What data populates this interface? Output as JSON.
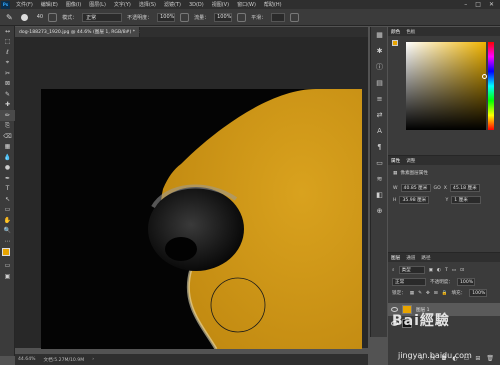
{
  "menubar": {
    "logo": "Ps",
    "items": [
      "文件(F)",
      "编辑(E)",
      "图像(I)",
      "图层(L)",
      "文字(Y)",
      "选择(S)",
      "滤镜(T)",
      "3D(D)",
      "视图(V)",
      "窗口(W)",
      "帮助(H)"
    ],
    "minimize": "–",
    "maximize": "□",
    "close": "✕"
  },
  "options": {
    "brush_size": "40",
    "mode_label": "模式：",
    "mode_value": "正常",
    "opacity_label": "不透明度：",
    "opacity_value": "100%",
    "flow_label": "流量：",
    "flow_value": "100%",
    "smoothing_label": "平滑："
  },
  "document": {
    "tab_title": "dog-188273_1920.jpg @ 44.6% (图层 1, RGB/8#) *",
    "tab_close": "×"
  },
  "status": {
    "zoom": "44.64%",
    "doc_info": "文档:5.27M/10.9M"
  },
  "color_panel": {
    "tabs": [
      "颜色",
      "色板"
    ],
    "foreground": "#e8a400",
    "background": "#000000"
  },
  "properties_panel": {
    "tabs": [
      "属性",
      "调整"
    ],
    "title": "像素图层属性",
    "w_label": "W",
    "w_value": "40.85 厘米",
    "x_label": "X",
    "x_value": "45.18 厘米",
    "h_label": "H",
    "h_value": "35.98 厘米",
    "y_label": "Y",
    "y_value": "1 厘米",
    "link_label": "GO"
  },
  "layers_panel": {
    "tabs": [
      "图层",
      "通道",
      "路径"
    ],
    "kind_filter": "类型",
    "blend_mode": "正常",
    "opacity_label": "不透明度：",
    "opacity_value": "100%",
    "lock_label": "锁定：",
    "fill_label": "填充：",
    "fill_value": "100%",
    "layers": [
      {
        "name": "图层 1",
        "selected": true,
        "thumb_color": "#e8a400"
      },
      {
        "name": "",
        "selected": false,
        "thumb_color": "#111111"
      }
    ]
  },
  "watermark": {
    "logo_text": "Bai經驗",
    "url": "jingyan.baidu.com"
  },
  "toolbar": {
    "tools": [
      "↔",
      "⬚",
      "ℓ",
      "⌖",
      "✂",
      "⊠",
      "✎",
      "✚",
      "✏",
      "⎘",
      "⌫",
      "▦",
      "💧",
      "●",
      "✒",
      "T",
      "↖",
      "▭",
      "✋",
      "🔍",
      "⋯"
    ]
  },
  "iconstrip": {
    "icons": [
      "▦",
      "✱",
      "ⓘ",
      "▤",
      "≡",
      "⇄",
      "A",
      "¶",
      "▭",
      "≋",
      "◧",
      "⊕"
    ]
  }
}
